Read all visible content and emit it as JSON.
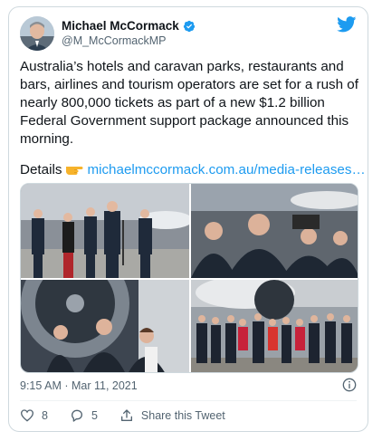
{
  "author": {
    "display_name": "Michael McCormack",
    "handle": "@M_McCormackMP",
    "verified": true
  },
  "tweet": {
    "text": "Australia’s hotels and caravan parks, restaurants and bars, airlines and tourism operators are set for a rush of nearly 800,000 tickets as part of a new $1.2 billion Federal Government support package announced this morning.",
    "details_label": "Details",
    "details_emoji_icon": "pointing-hand-icon",
    "link_text": "michaelmccormack.com.au/media-releases…"
  },
  "media": {
    "photos": [
      "press-conference-hangar-photo",
      "group-conversation-photo",
      "jet-engine-portrait-photo",
      "crew-group-photo"
    ]
  },
  "meta": {
    "timestamp": "9:15 AM · Mar 11, 2021"
  },
  "actions": {
    "like_count": "8",
    "reply_count": "5",
    "share_label": "Share this Tweet"
  },
  "colors": {
    "link": "#1d9bf0",
    "secondary_text": "#536471",
    "border": "#cfd9de",
    "like_heart": "#536471"
  }
}
